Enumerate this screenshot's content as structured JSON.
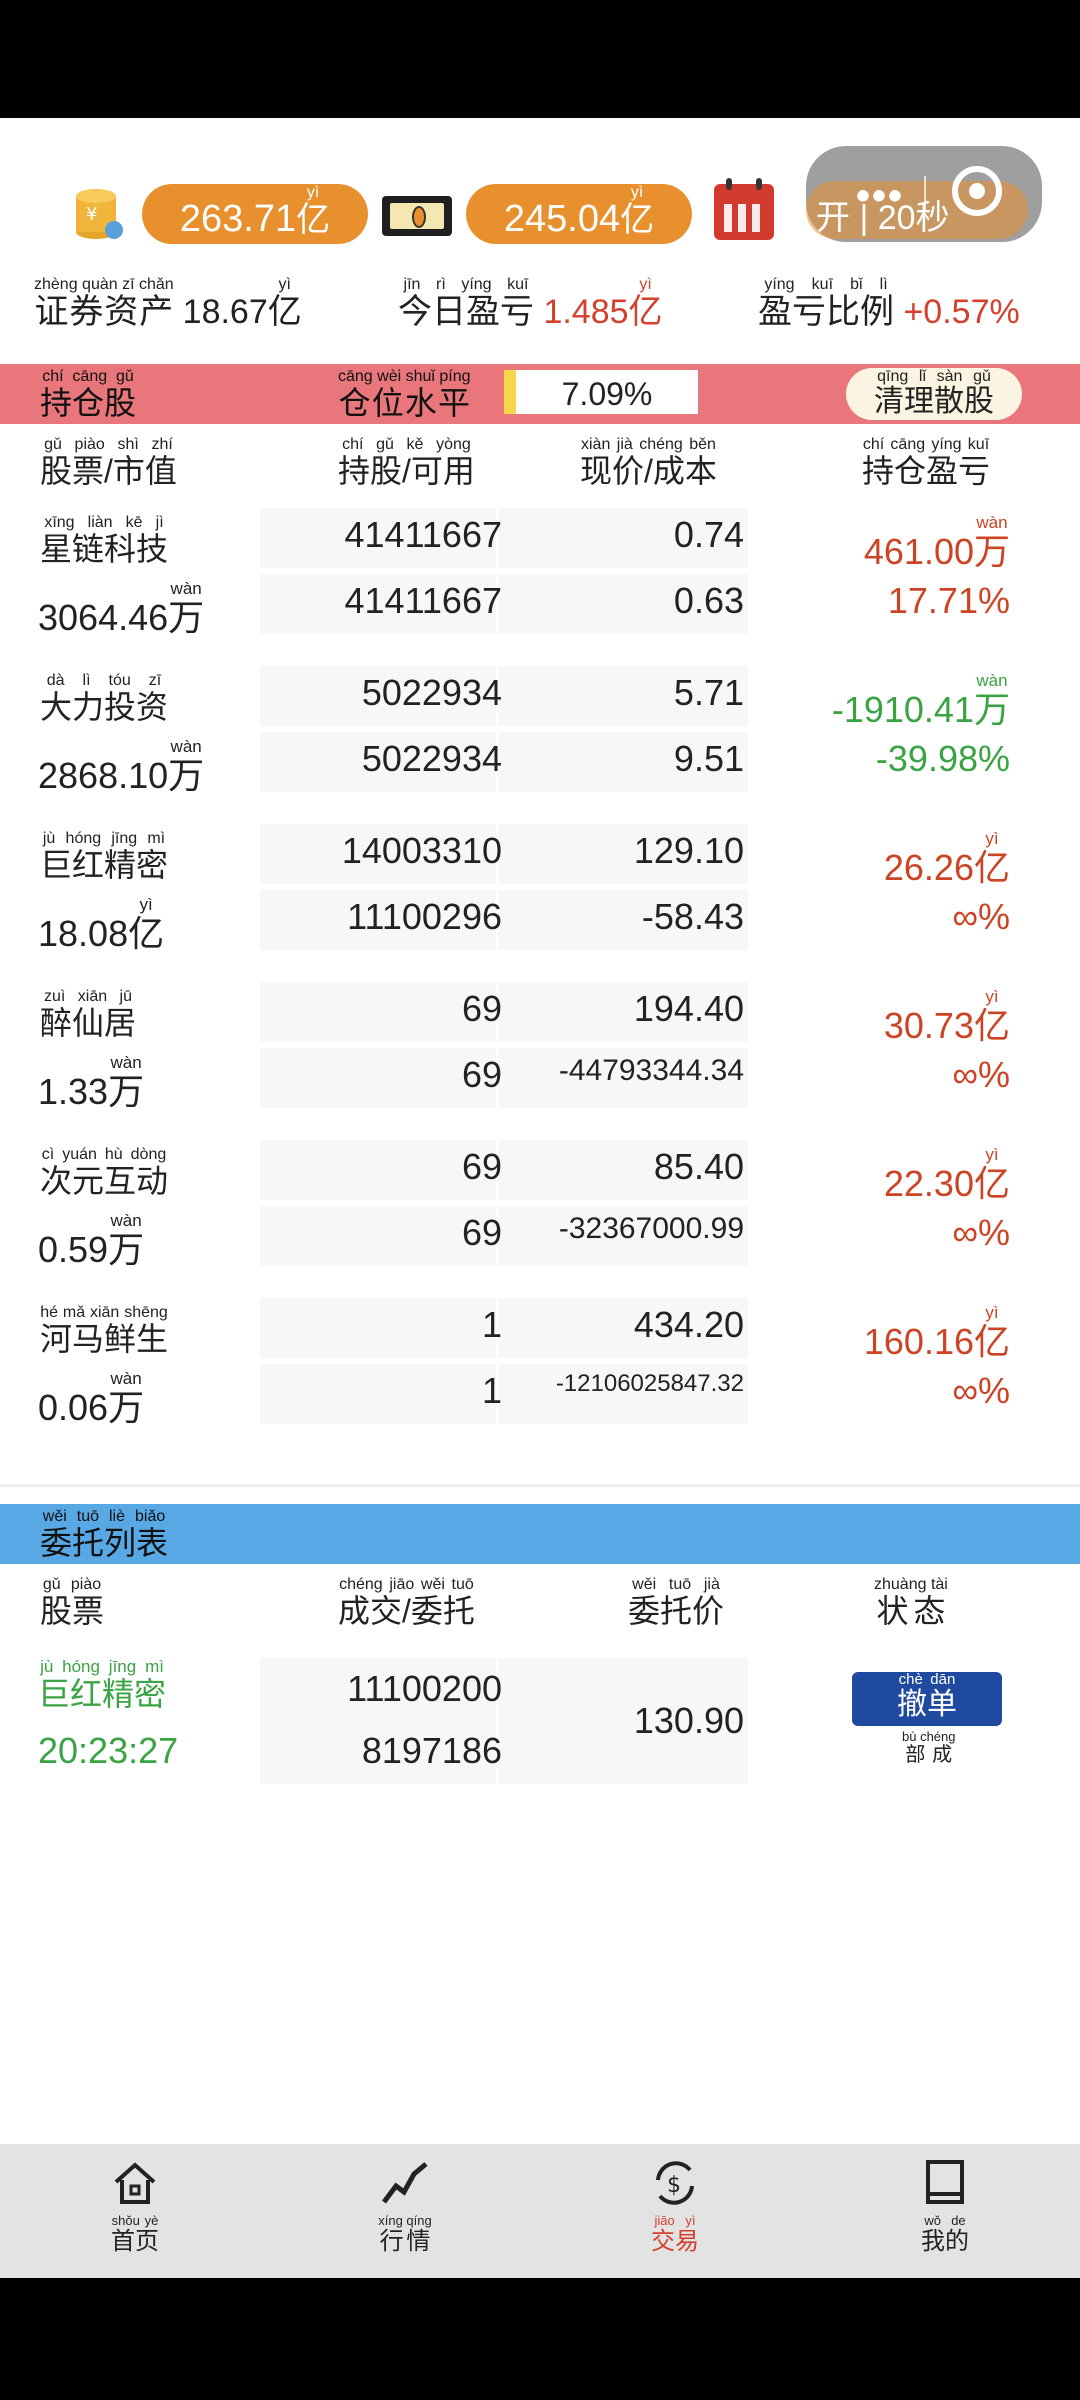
{
  "balances": {
    "total": "263.71",
    "total_unit": "亿",
    "cash": "245.04",
    "cash_unit": "亿",
    "timer": "开 | 20秒"
  },
  "summary": {
    "asset_label": "证券资产",
    "asset_value": "18.67",
    "asset_unit": "亿",
    "today_label": "今日盈亏",
    "today_value": "1.485",
    "today_unit": "亿",
    "ratio_label": "盈亏比例",
    "ratio_value": "+0.57%"
  },
  "holdings_section": {
    "title": "持仓股",
    "level_label": "仓位水平",
    "level_value": "7.09%",
    "clear_button": "清理散股"
  },
  "holding_columns": {
    "stock": "股票/市值",
    "qty": "持股/可用",
    "price": "现价/成本",
    "pnl": "持仓盈亏"
  },
  "holdings": [
    {
      "name": "星链科技",
      "py": [
        "xīng",
        "liàn",
        "kē",
        "jì"
      ],
      "mv": "3064.46",
      "mv_unit": "万",
      "held": "41411667",
      "avail": "41411667",
      "price": "0.74",
      "cost": "0.63",
      "pnl": "461.00",
      "pnl_unit": "万",
      "pnl_pct": "17.71%",
      "tone": "red"
    },
    {
      "name": "大力投资",
      "py": [
        "dà",
        "lì",
        "tóu",
        "zī"
      ],
      "mv": "2868.10",
      "mv_unit": "万",
      "held": "5022934",
      "avail": "5022934",
      "price": "5.71",
      "cost": "9.51",
      "pnl": "-1910.41",
      "pnl_unit": "万",
      "pnl_pct": "-39.98%",
      "tone": "green"
    },
    {
      "name": "巨红精密",
      "py": [
        "jù",
        "hóng",
        "jīng",
        "mì"
      ],
      "mv": "18.08",
      "mv_unit": "亿",
      "held": "14003310",
      "avail": "11100296",
      "price": "129.10",
      "cost": "-58.43",
      "pnl": "26.26",
      "pnl_unit": "亿",
      "pnl_pct": "∞%",
      "tone": "red"
    },
    {
      "name": "醉仙居",
      "py": [
        "zuì",
        "xiān",
        "jū"
      ],
      "mv": "1.33",
      "mv_unit": "万",
      "held": "69",
      "avail": "69",
      "price": "194.40",
      "cost": "-44793344.34",
      "pnl": "30.73",
      "pnl_unit": "亿",
      "pnl_pct": "∞%",
      "tone": "red"
    },
    {
      "name": "次元互动",
      "py": [
        "cì",
        "yuán",
        "hù",
        "dòng"
      ],
      "mv": "0.59",
      "mv_unit": "万",
      "held": "69",
      "avail": "69",
      "price": "85.40",
      "cost": "-32367000.99",
      "pnl": "22.30",
      "pnl_unit": "亿",
      "pnl_pct": "∞%",
      "tone": "red"
    },
    {
      "name": "河马鲜生",
      "py": [
        "hé",
        "mǎ",
        "xiān",
        "shēng"
      ],
      "mv": "0.06",
      "mv_unit": "万",
      "held": "1",
      "avail": "1",
      "price": "434.20",
      "cost": "-12106025847.32",
      "pnl": "160.16",
      "pnl_unit": "亿",
      "pnl_pct": "∞%",
      "tone": "red"
    }
  ],
  "orders_section": {
    "title": "委托列表",
    "col_stock": "股票",
    "col_filled": "成交/委托",
    "col_price": "委托价",
    "col_status": "状态"
  },
  "orders": [
    {
      "name": "巨红精密",
      "time": "20:23:27",
      "filled": "11100200",
      "ordered": "8197186",
      "price": "130.90",
      "cancel": "撤单",
      "status": "部成"
    }
  ],
  "nav": {
    "home": "首页",
    "market": "行情",
    "trade": "交易",
    "mine": "我的"
  },
  "colors": {
    "accent_orange": "#e9902e",
    "hold_header": "#e8767a",
    "order_header": "#57a8e4",
    "red": "#d4402e",
    "green": "#3aa344",
    "cancel_button": "#1f4aa0"
  }
}
